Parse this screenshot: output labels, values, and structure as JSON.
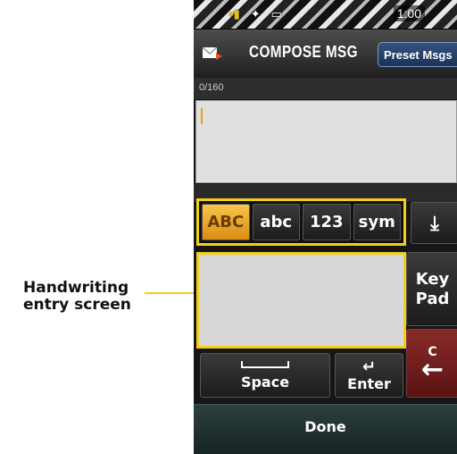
{
  "callout": {
    "line1": "Handwriting",
    "line2": "entry screen"
  },
  "status_bar": {
    "time": "1:00",
    "icons": [
      "signal-icon",
      "gps-icon",
      "battery-icon"
    ]
  },
  "header": {
    "title": "COMPOSE MSG",
    "preset_button": "Preset Msgs"
  },
  "message": {
    "counter": "0/160",
    "body": ""
  },
  "input_modes": {
    "active": "ABC",
    "items": [
      "ABC",
      "abc",
      "123",
      "sym"
    ]
  },
  "side_buttons": {
    "keypad_line1": "Key",
    "keypad_line2": "Pad",
    "clear_top": "C"
  },
  "bottom_keys": {
    "space": "Space",
    "enter": "Enter",
    "done": "Done"
  },
  "colors": {
    "highlight_border": "#f2cf1c",
    "active_mode": "#e8a317",
    "clear_button": "#7a2020"
  }
}
